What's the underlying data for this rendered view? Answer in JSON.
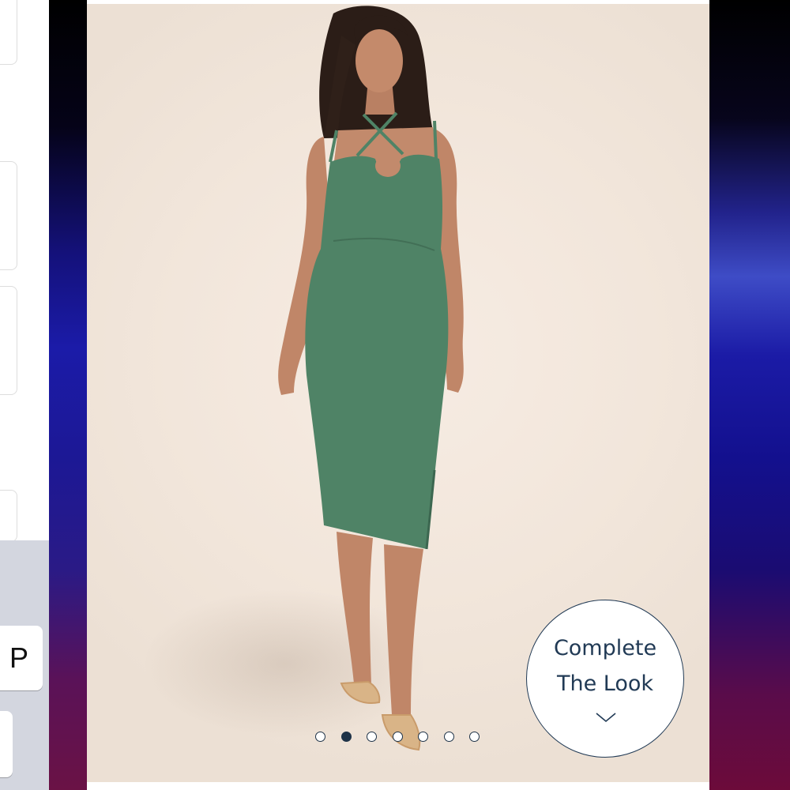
{
  "keyboard": {
    "visible_key": "P"
  },
  "product_image": {
    "alt": "Model wearing a green strappy cutout midi dress with a side slit",
    "dress_color": "#4f8366",
    "background_color": "#f2e6db"
  },
  "complete_the_look": {
    "line1": "Complete",
    "line2": "The Look",
    "icon": "chevron-down-icon",
    "accent_color": "#213a55"
  },
  "carousel": {
    "total": 7,
    "active_index": 1
  }
}
